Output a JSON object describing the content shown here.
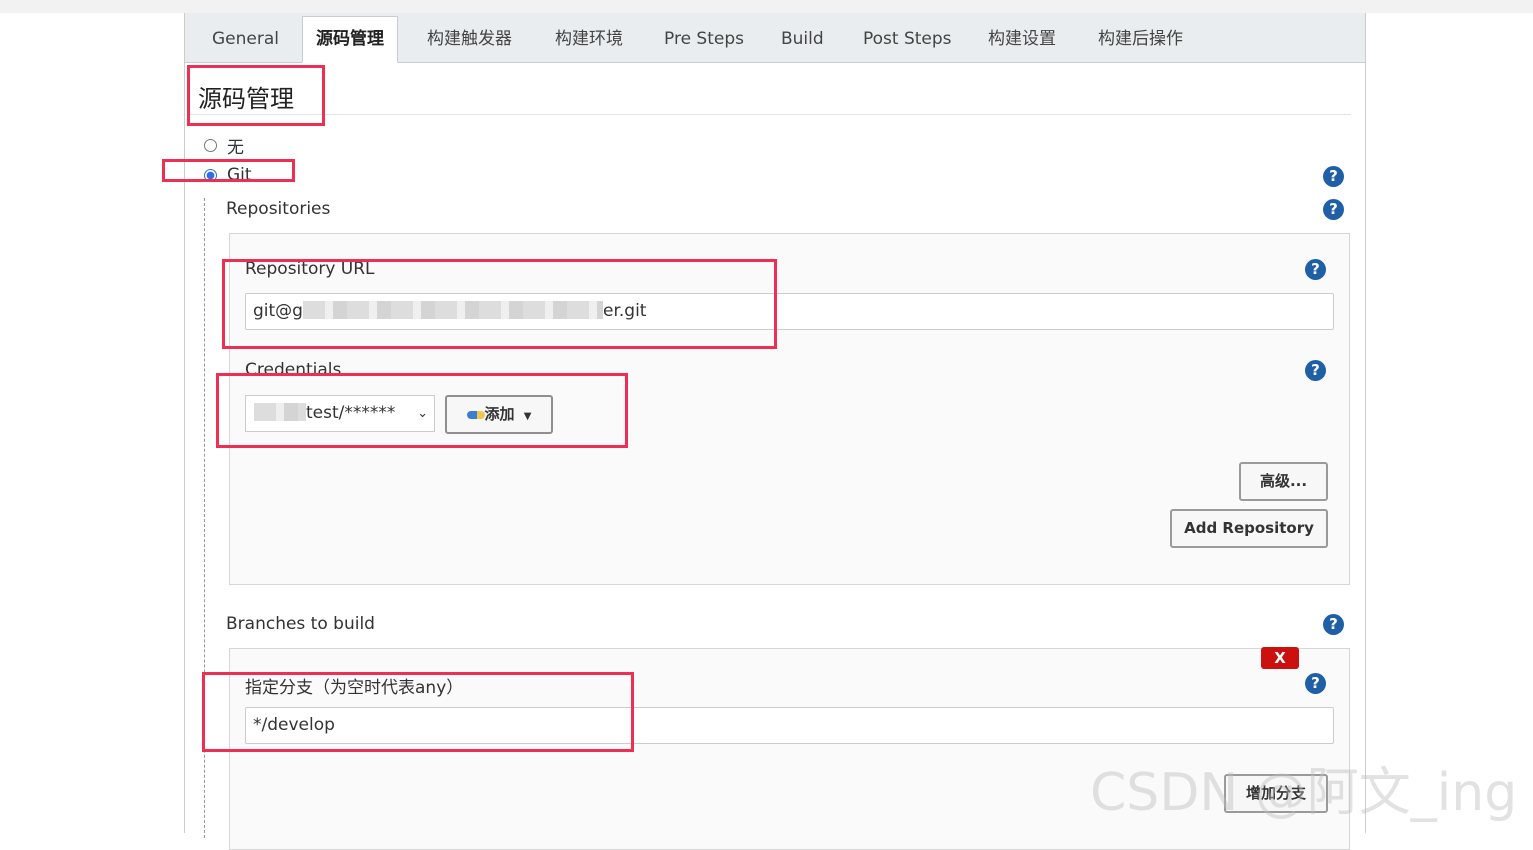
{
  "tabs": [
    {
      "label": "General"
    },
    {
      "label": "源码管理"
    },
    {
      "label": "构建触发器"
    },
    {
      "label": "构建环境"
    },
    {
      "label": "Pre Steps"
    },
    {
      "label": "Build"
    },
    {
      "label": "Post Steps"
    },
    {
      "label": "构建设置"
    },
    {
      "label": "构建后操作"
    }
  ],
  "active_tab": "源码管理",
  "section": {
    "title": "源码管理"
  },
  "scm_options": [
    {
      "label": "无",
      "selected": false
    },
    {
      "label": "Git",
      "selected": true
    }
  ],
  "repositories": {
    "label": "Repositories",
    "repository_url": {
      "label": "Repository URL",
      "value_prefix": "git@g",
      "value_suffix": "er.git"
    },
    "credentials": {
      "label": "Credentials",
      "selected_suffix": "test/******",
      "add_button": "添加"
    },
    "advanced_button": "高级...",
    "add_repository_button": "Add Repository"
  },
  "branches": {
    "label": "Branches to build",
    "delete_button": "X",
    "branch_specifier_label": "指定分支（为空时代表any）",
    "branch_value": "*/develop",
    "add_branch_button": "增加分支"
  },
  "help_symbol": "?",
  "watermark": "CSDN @阿文_ing",
  "colors": {
    "annotation_red": "#ec2f53",
    "help_blue": "#1f5fa6",
    "delete_red": "#cc1010"
  }
}
